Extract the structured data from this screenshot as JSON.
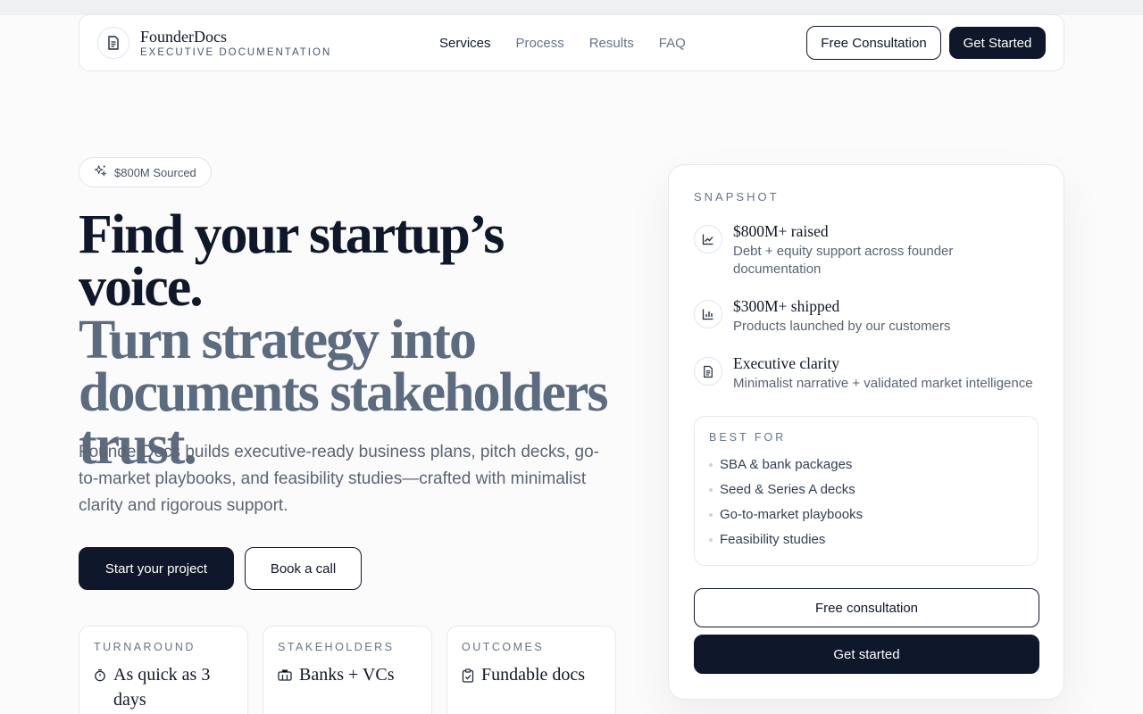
{
  "nav": {
    "brand_name": "FounderDocs",
    "brand_tagline": "EXECUTIVE DOCUMENTATION",
    "links": [
      {
        "label": "Services",
        "active": true
      },
      {
        "label": "Process",
        "active": false
      },
      {
        "label": "Results",
        "active": false
      },
      {
        "label": "FAQ",
        "active": false
      }
    ],
    "consult_label": "Free Consultation",
    "get_started_label": "Get Started"
  },
  "hero": {
    "badge": "$800M Sourced",
    "headline_1": "Find your startup’s voice.",
    "headline_2": "Turn strategy into documents stakeholders trust.",
    "lede": "FounderDocs builds executive-ready business plans, pitch decks, go-to-market playbooks, and feasibility studies—crafted with minimalist clarity and rigorous support.",
    "primary_cta": "Start your project",
    "secondary_cta": "Book a call"
  },
  "mini_cards": [
    {
      "label": "TURNAROUND",
      "value": "As quick as 3 days",
      "icon": "timer-icon"
    },
    {
      "label": "STAKEHOLDERS",
      "value": "Banks + VCs",
      "icon": "bank-icon"
    },
    {
      "label": "OUTCOMES",
      "value": "Fundable docs",
      "icon": "clipboard-check-icon"
    }
  ],
  "snapshot": {
    "label": "SNAPSHOT",
    "stats": [
      {
        "title": "$800M+ raised",
        "desc": "Debt + equity support across founder documentation",
        "icon": "line-chart-icon"
      },
      {
        "title": "$300M+ shipped",
        "desc": "Products launched by our customers",
        "icon": "bar-chart-icon"
      },
      {
        "title": "Executive clarity",
        "desc": "Minimalist narrative + validated market intelligence",
        "icon": "document-icon"
      }
    ],
    "best_for_label": "BEST FOR",
    "best_for": [
      "SBA & bank packages",
      "Seed & Series A decks",
      "Go-to-market playbooks",
      "Feasibility studies"
    ],
    "consult_label": "Free consultation",
    "get_started_label": "Get started"
  },
  "colors": {
    "dark": "#0f172a",
    "muted_headline": "#5b6b80",
    "body_text": "#5b6474",
    "border": "#e6e8ec"
  }
}
